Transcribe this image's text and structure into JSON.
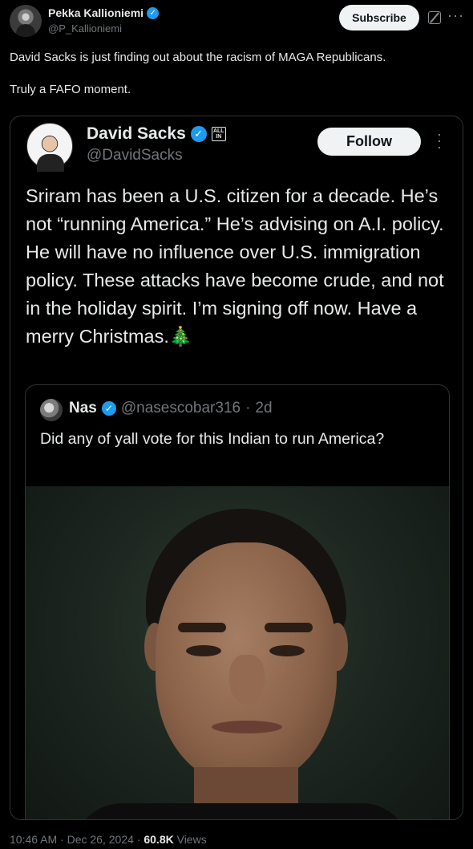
{
  "header": {
    "name": "Pekka Kallioniemi",
    "handle": "@P_Kallioniemi",
    "subscribe_label": "Subscribe",
    "icons": [
      "verified-badge-icon",
      "grok-icon",
      "more-options-icon"
    ]
  },
  "tweet": {
    "paragraphs": [
      "David Sacks is just finding out about the racism of MAGA Republicans.",
      "Truly a FAFO moment."
    ]
  },
  "card": {
    "name": "David Sacks",
    "badge_text": "ALL IN",
    "handle": "@DavidSacks",
    "follow_label": "Follow",
    "text": "Sriram has been a U.S. citizen for a decade. He’s not “running America.” He’s advising on A.I. policy. He will have no influence over U.S. immigration policy. These attacks have become crude, and not in the holiday spirit. I’m signing off now. Have a merry Christmas.🎄",
    "quote": {
      "name": "Nas",
      "handle": "@nasescobar316",
      "time": "2d",
      "text": "Did any of yall vote for this Indian to run America?"
    }
  },
  "footer": {
    "time": "10:46 AM",
    "date": "Dec 26, 2024",
    "views_count": "60.8K",
    "views_label": "Views"
  },
  "colors": {
    "background": "#000000",
    "text": "#e7e9ea",
    "secondary": "#71767b",
    "verified": "#1d9bf0",
    "border": "#2f3336"
  }
}
